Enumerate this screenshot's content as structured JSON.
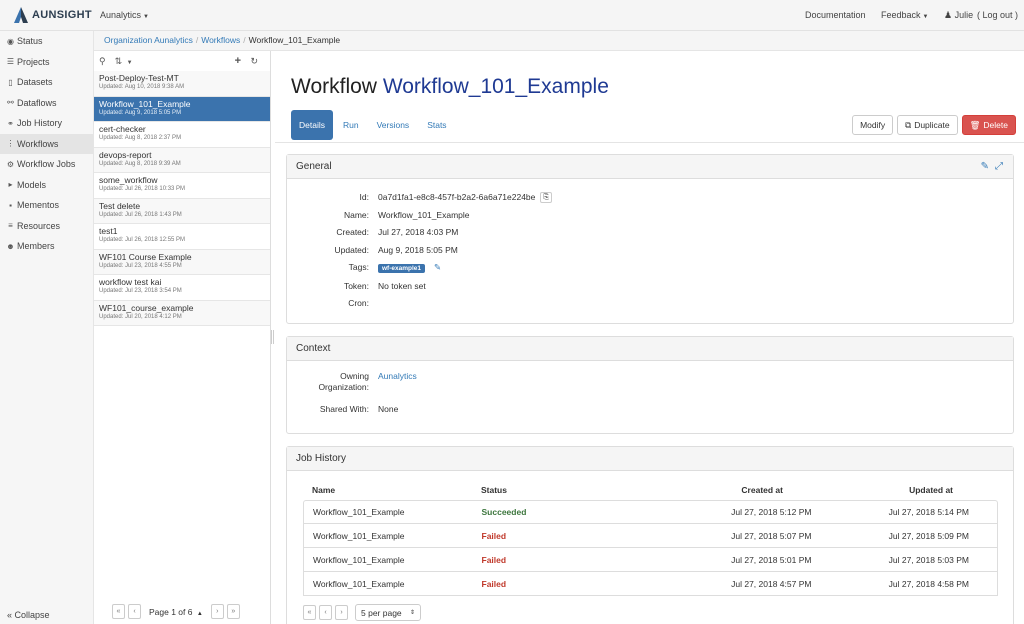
{
  "brand": {
    "name": "AUNSIGHT",
    "org_menu": "Aunalytics"
  },
  "topnav": {
    "documentation": "Documentation",
    "feedback": "Feedback",
    "user": "Julie",
    "logout": "( Log out )"
  },
  "sidebar": {
    "items": [
      {
        "label": "Status",
        "icon": "dashboard-icon"
      },
      {
        "label": "Projects",
        "icon": "list-icon"
      },
      {
        "label": "Datasets",
        "icon": "file-icon"
      },
      {
        "label": "Dataflows",
        "icon": "sitemap-icon"
      },
      {
        "label": "Job History",
        "icon": "network-icon"
      },
      {
        "label": "Workflows",
        "icon": "workflow-icon"
      },
      {
        "label": "Workflow Jobs",
        "icon": "cogs-icon"
      },
      {
        "label": "Models",
        "icon": "model-icon"
      },
      {
        "label": "Mementos",
        "icon": "memento-icon"
      },
      {
        "label": "Resources",
        "icon": "resources-icon"
      },
      {
        "label": "Members",
        "icon": "users-icon"
      }
    ],
    "collapse": "« Collapse"
  },
  "breadcrumb": [
    "Organization Aunalytics",
    "Workflows",
    "Workflow_101_Example"
  ],
  "workflows": [
    {
      "name": "Post-Deploy-Test-MT",
      "updated": "Updated:  Aug 10, 2018 9:38 AM"
    },
    {
      "name": "Workflow_101_Example",
      "updated": "Updated:  Aug 9, 2018 5:05 PM"
    },
    {
      "name": "cert-checker",
      "updated": "Updated:  Aug 8, 2018 2:37 PM"
    },
    {
      "name": "devops-report",
      "updated": "Updated:  Aug 8, 2018 9:39 AM"
    },
    {
      "name": "some_workflow",
      "updated": "Updated:  Jul 26, 2018 10:33 PM"
    },
    {
      "name": "Test delete",
      "updated": "Updated:  Jul 26, 2018 1:43 PM"
    },
    {
      "name": "test1",
      "updated": "Updated:  Jul 26, 2018 12:55 PM"
    },
    {
      "name": "WF101 Course Example",
      "updated": "Updated:  Jul 23, 2018 4:55 PM"
    },
    {
      "name": "workflow test kai",
      "updated": "Updated:  Jul 23, 2018 3:54 PM"
    },
    {
      "name": "WF101_course_example",
      "updated": "Updated:  Jul 20, 2018 4:12 PM"
    }
  ],
  "list_pager": "Page 1 of 6",
  "title": {
    "prefix": "Workflow",
    "name": "Workflow_101_Example"
  },
  "tabs": [
    "Details",
    "Run",
    "Versions",
    "Stats"
  ],
  "actions": {
    "modify": "Modify",
    "duplicate": "Duplicate",
    "delete": "Delete"
  },
  "general": {
    "heading": "General",
    "id_label": "Id:",
    "id": "0a7d1fa1-e8c8-457f-b2a2-6a6a71e224be",
    "name_label": "Name:",
    "name": "Workflow_101_Example",
    "created_label": "Created:",
    "created": "Jul 27, 2018 4:03 PM",
    "updated_label": "Updated:",
    "updated": "Aug 9, 2018 5:05 PM",
    "tags_label": "Tags:",
    "tag": "wf-example1",
    "token_label": "Token:",
    "token": "No token set",
    "cron_label": "Cron:"
  },
  "context": {
    "heading": "Context",
    "owning_label1": "Owning",
    "owning_label2": "Organization:",
    "owning": "Aunalytics",
    "shared_label": "Shared With:",
    "shared": "None"
  },
  "job_history": {
    "heading": "Job History",
    "columns": [
      "Name",
      "Status",
      "Created at",
      "Updated at"
    ],
    "rows": [
      {
        "name": "Workflow_101_Example",
        "status": "Succeeded",
        "created": "Jul 27, 2018 5:12 PM",
        "updated": "Jul 27, 2018 5:14 PM"
      },
      {
        "name": "Workflow_101_Example",
        "status": "Failed",
        "created": "Jul 27, 2018 5:07 PM",
        "updated": "Jul 27, 2018 5:09 PM"
      },
      {
        "name": "Workflow_101_Example",
        "status": "Failed",
        "created": "Jul 27, 2018 5:01 PM",
        "updated": "Jul 27, 2018 5:03 PM"
      },
      {
        "name": "Workflow_101_Example",
        "status": "Failed",
        "created": "Jul 27, 2018 4:57 PM",
        "updated": "Jul 27, 2018 4:58 PM"
      }
    ],
    "per_page": "5 per page"
  },
  "colors": {
    "accent": "#3b73ad",
    "danger": "#d9534f",
    "success": "#3c763d",
    "fail": "#c0392b"
  }
}
